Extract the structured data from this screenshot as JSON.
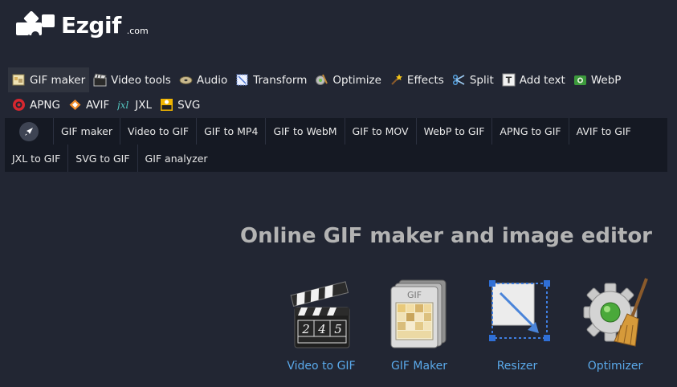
{
  "logo": {
    "word": "Ezgif",
    "tld": ".com"
  },
  "nav": {
    "row1": [
      {
        "label": "GIF maker",
        "icon": "gif-maker-icon",
        "active": true
      },
      {
        "label": "Video tools",
        "icon": "film-icon"
      },
      {
        "label": "Audio",
        "icon": "audio-icon"
      },
      {
        "label": "Transform",
        "icon": "transform-icon"
      },
      {
        "label": "Optimize",
        "icon": "optimize-icon"
      },
      {
        "label": "Effects",
        "icon": "effects-icon"
      },
      {
        "label": "Split",
        "icon": "scissors-icon"
      },
      {
        "label": "Add text",
        "icon": "text-icon"
      },
      {
        "label": "WebP",
        "icon": "webp-icon"
      }
    ],
    "row2": [
      {
        "label": "APNG",
        "icon": "apng-icon"
      },
      {
        "label": "AVIF",
        "icon": "avif-icon"
      },
      {
        "label": "JXL",
        "icon": "jxl-icon"
      },
      {
        "label": "SVG",
        "icon": "svg-icon"
      }
    ]
  },
  "subnav": {
    "row1": [
      "GIF maker",
      "Video to GIF",
      "GIF to MP4",
      "GIF to WebM",
      "GIF to MOV",
      "WebP to GIF",
      "APNG to GIF",
      "AVIF to GIF"
    ],
    "row2": [
      "JXL to GIF",
      "SVG to GIF",
      "GIF analyzer"
    ]
  },
  "headline": "Online GIF maker and image editor",
  "tools": [
    {
      "label": "Video to GIF",
      "icon": "clapperboard-icon",
      "clap_numbers": [
        "2",
        "4",
        "5"
      ]
    },
    {
      "label": "GIF Maker",
      "icon": "gif-stack-icon",
      "badge": "GIF"
    },
    {
      "label": "Resizer",
      "icon": "resize-frame-icon"
    },
    {
      "label": "Optimizer",
      "icon": "gear-broom-icon"
    }
  ],
  "colors": {
    "background": "#222633",
    "subnav_bg": "#151923",
    "link": "#5aa9ea",
    "headline": "#b3b3b3"
  }
}
